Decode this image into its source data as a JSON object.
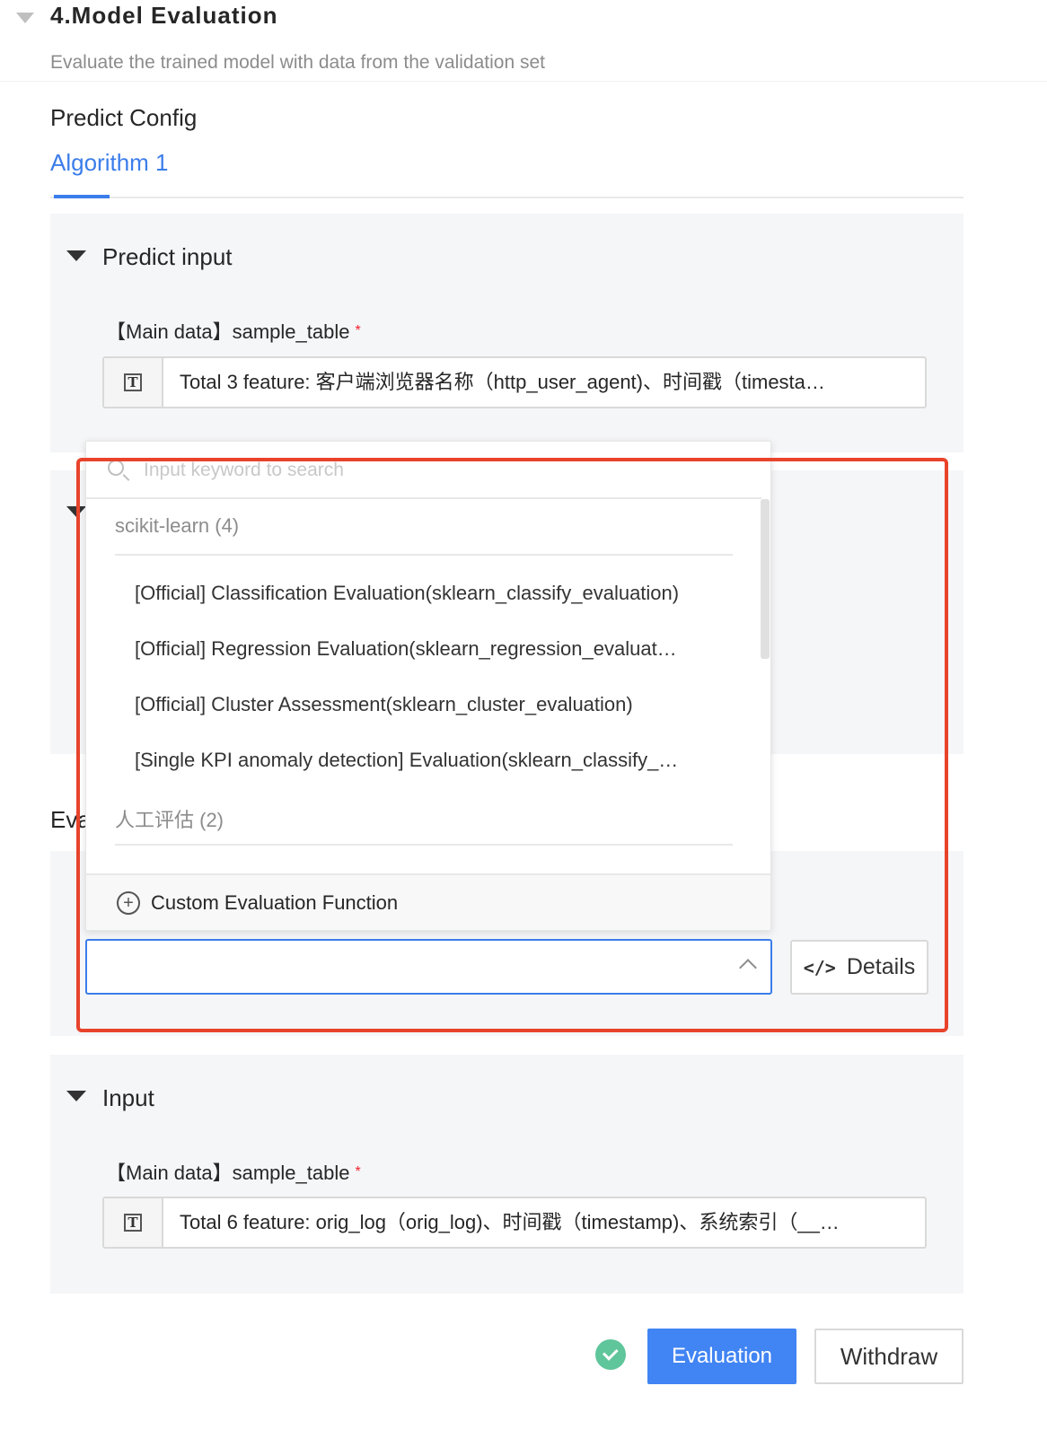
{
  "section": {
    "title": "4.Model Evaluation",
    "description": "Evaluate the trained model with data from the validation set"
  },
  "predict_config": {
    "title": "Predict Config",
    "tabs": [
      {
        "label": "Algorithm 1",
        "active": true
      }
    ]
  },
  "predict_input": {
    "heading": "Predict input",
    "field_label": "【Main data】sample_table",
    "required_mark": "*",
    "feature_value": "Total 3 feature: 客户端浏览器名称（http_user_agent)、时间戳（timesta…"
  },
  "hidden_label_fragment": "Eva",
  "dropdown": {
    "search_placeholder": "Input keyword to search",
    "groups": [
      {
        "title": "scikit-learn (4)",
        "options": [
          "[Official] Classification Evaluation(sklearn_classify_evaluation)",
          "[Official] Regression Evaluation(sklearn_regression_evaluat…",
          "[Official] Cluster Assessment(sklearn_cluster_evaluation)",
          "[Single KPI anomaly detection] Evaluation(sklearn_classify_…"
        ]
      },
      {
        "title": "人工评估 (2)",
        "options": []
      }
    ],
    "footer_label": "Custom Evaluation Function"
  },
  "select": {
    "value": "",
    "details_label": "Details"
  },
  "input_section": {
    "heading": "Input",
    "field_label": "【Main data】sample_table",
    "required_mark": "*",
    "feature_value": "Total 6 feature: orig_log（orig_log)、时间戳（timestamp)、系统索引（__…"
  },
  "actions": {
    "evaluate_label": "Evaluation",
    "withdraw_label": "Withdraw"
  },
  "colors": {
    "accent": "#3b7de9",
    "primary_button": "#4184f3",
    "highlight_border": "#e8432b",
    "success": "#5fc59a",
    "required": "#f5222d"
  },
  "icons": [
    "collapse-caret-icon",
    "panel-caret-icon",
    "text-type-icon",
    "search-icon",
    "plus-circle-icon",
    "chevron-up-icon",
    "code-icon",
    "check-circle-icon"
  ]
}
